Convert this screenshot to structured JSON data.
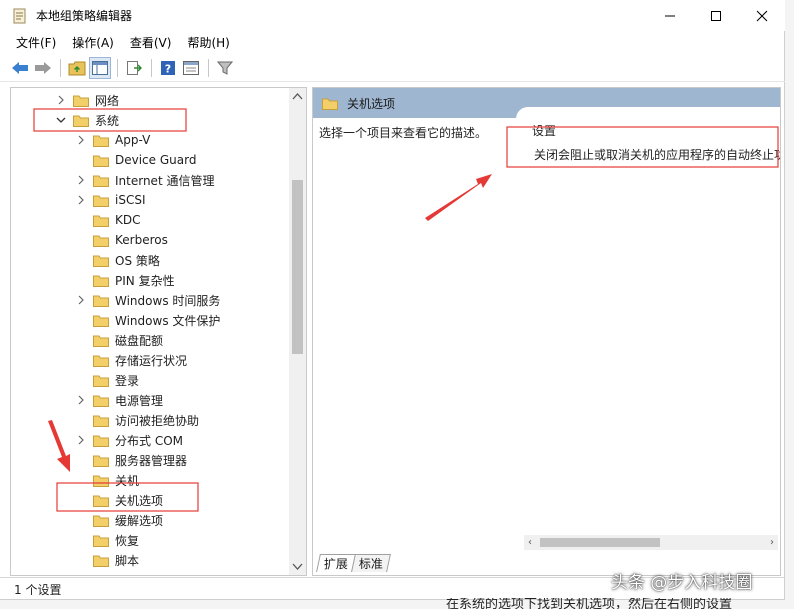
{
  "window": {
    "title": "本地组策略编辑器",
    "controls": [
      "minimize",
      "maximize",
      "close"
    ]
  },
  "menu": {
    "items": [
      "文件(F)",
      "操作(A)",
      "查看(V)",
      "帮助(H)"
    ]
  },
  "toolbar": {
    "buttons": [
      "back-icon",
      "forward-icon",
      "up-folder-icon",
      "show-hide-tree-icon",
      "export-list-icon",
      "help-icon",
      "properties-icon",
      "filter-icon"
    ]
  },
  "tree": {
    "items": [
      {
        "label": "网络",
        "expander": "collapsed"
      },
      {
        "label": "系统",
        "expander": "expanded"
      },
      {
        "label": "App-V",
        "expander": "collapsed"
      },
      {
        "label": "Device Guard",
        "expander": "none"
      },
      {
        "label": "Internet 通信管理",
        "expander": "collapsed"
      },
      {
        "label": "iSCSI",
        "expander": "collapsed"
      },
      {
        "label": "KDC",
        "expander": "none"
      },
      {
        "label": "Kerberos",
        "expander": "none"
      },
      {
        "label": "OS 策略",
        "expander": "none"
      },
      {
        "label": "PIN 复杂性",
        "expander": "none"
      },
      {
        "label": "Windows 时间服务",
        "expander": "collapsed"
      },
      {
        "label": "Windows 文件保护",
        "expander": "none"
      },
      {
        "label": "磁盘配额",
        "expander": "none"
      },
      {
        "label": "存储运行状况",
        "expander": "none"
      },
      {
        "label": "登录",
        "expander": "none"
      },
      {
        "label": "电源管理",
        "expander": "collapsed"
      },
      {
        "label": "访问被拒绝协助",
        "expander": "none"
      },
      {
        "label": "分布式 COM",
        "expander": "collapsed"
      },
      {
        "label": "服务器管理器",
        "expander": "none"
      },
      {
        "label": "关机",
        "expander": "none"
      },
      {
        "label": "关机选项",
        "expander": "none"
      },
      {
        "label": "缓解选项",
        "expander": "none"
      },
      {
        "label": "恢复",
        "expander": "none"
      },
      {
        "label": "脚本",
        "expander": "none"
      }
    ]
  },
  "details": {
    "header": "关机选项",
    "description": "选择一个项目来查看它的描述。",
    "column_header": "设置",
    "rows": [
      "关闭会阻止或取消关机的应用程序的自动终止功能"
    ],
    "tabs": [
      "扩展",
      "标准"
    ]
  },
  "status": {
    "text": "1 个设置"
  },
  "annotation": {
    "color": "#e53935"
  },
  "watermark": "头条 @步入科技圈",
  "background_text": "在系统的选项下找到关机选项，然后在右侧的设置"
}
